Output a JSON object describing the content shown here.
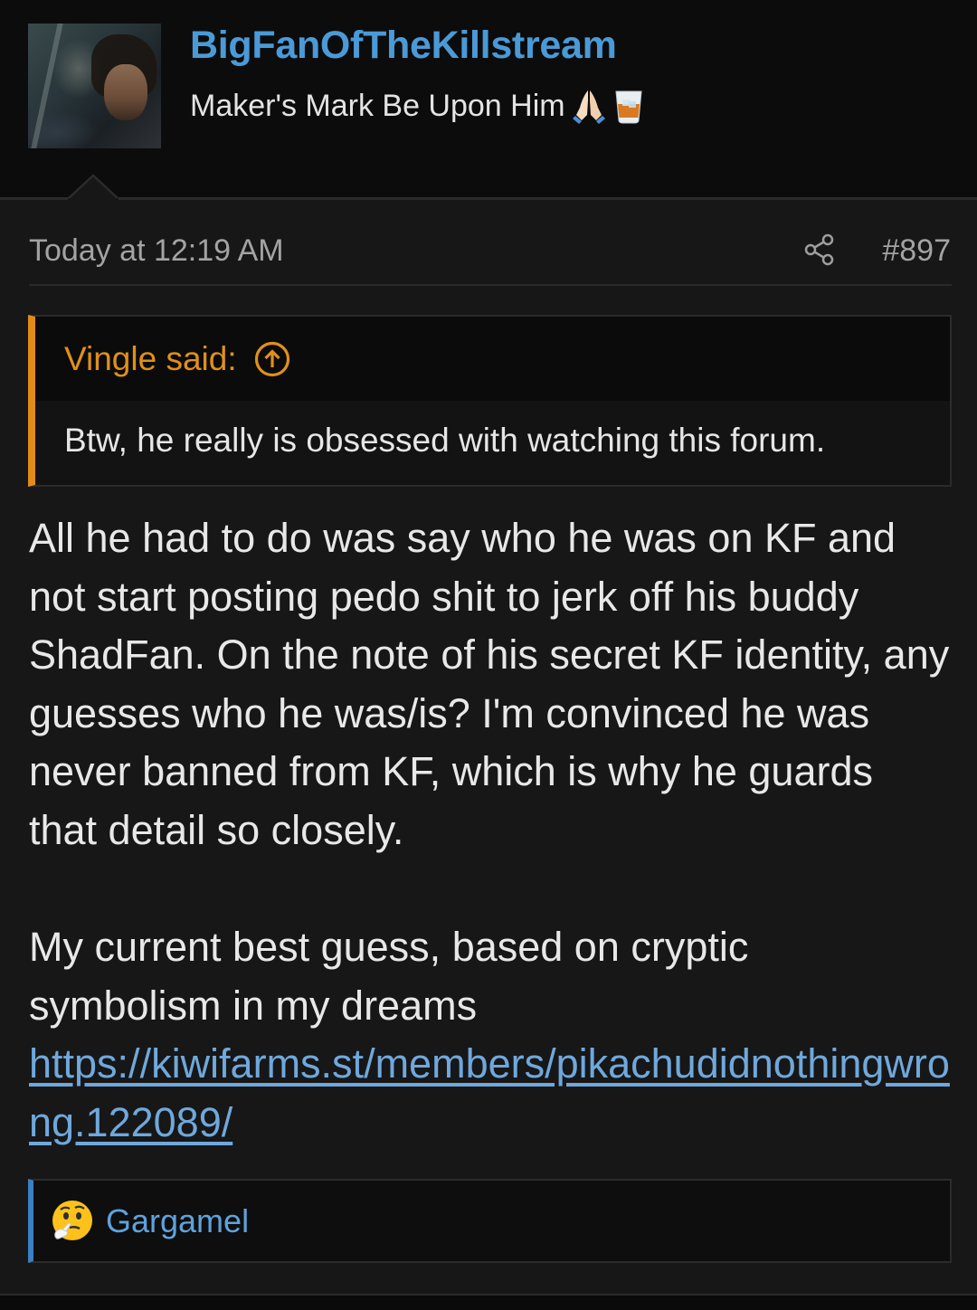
{
  "user": {
    "name": "BigFanOfTheKillstream",
    "title": "Maker's Mark Be Upon Him",
    "title_emojis": [
      "folded-hands-icon",
      "tumbler-glass-icon"
    ]
  },
  "post": {
    "date": "Today at 12:19 AM",
    "number": "#897",
    "share_icon": "share-icon"
  },
  "quote": {
    "author": "Vingle said:",
    "jump_icon": "arrow-up-circle-icon",
    "text": "Btw, he really is obsessed with watching this forum."
  },
  "message": {
    "paragraph1": "All he had to do was say who he was on KF and\nnot start posting pedo shit to jerk off his buddy\nShadFan. On the note of his secret KF identity, any\nguesses who he was/is? I'm convinced he was\nnever banned from KF, which is why he guards\nthat detail so closely.",
    "paragraph2": "My current best guess, based on cryptic\nsymbolism in my dreams",
    "link": "https://kiwifarms.st/members/pikachudidnothingwrong.122089/"
  },
  "reactions": {
    "emoji": "thinking-face-icon",
    "users": "Gargamel"
  },
  "colors": {
    "background": "#171717",
    "header_background": "#0c0c0c",
    "username": "#4a9ad7",
    "quote_accent": "#e08c17",
    "reaction_accent": "#3a80c4",
    "link": "#6fa8dc"
  }
}
